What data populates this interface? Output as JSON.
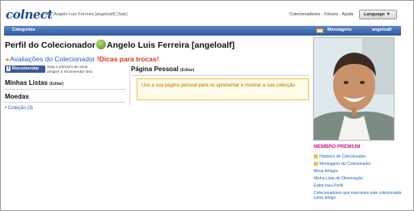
{
  "header": {
    "logo": "colnect",
    "greeting": "Olá, Angelo Luis Ferreira [angeloalf] (Sair)",
    "top_links": "Colecionadores · Fóruns · Ajuda",
    "language_button": "Language ▼"
  },
  "navbar": {
    "categories": "Categorias",
    "messages": "Mensagens",
    "username": "angeloalf"
  },
  "profile": {
    "title_prefix": "Perfil do Colecionador",
    "name": "Angelo Luis Ferreira [angeloalf]",
    "ratings_link": "Avaliações do Colecionador",
    "tips_link": "!Dicas para trocas!",
    "fb_button": "Recomendar",
    "fb_text": "Seja o primeiro de seus amigos a recomendar isso."
  },
  "sections": {
    "lists_title": "Minhas Listas",
    "lists_edit": "(Editar)",
    "coins_title": "Moedas",
    "collection_item": "Coleção",
    "collection_count": "(3)",
    "personal_title": "Página Pessoal",
    "personal_edit": "(Editar)",
    "personal_notice": "Use a sua página pessoal para se apresentar e mostrar a sua colecção"
  },
  "sidebar": {
    "membership": "MEMBRO PREMIUM",
    "links": [
      "Histórico do Colecionador",
      "Mensagens do Colecionador",
      "Meus Amigos",
      "Minha Lista de Observação",
      "Exibir meu Perfil",
      "Colecionadores que marcaram este colecionador como amigo"
    ]
  }
}
